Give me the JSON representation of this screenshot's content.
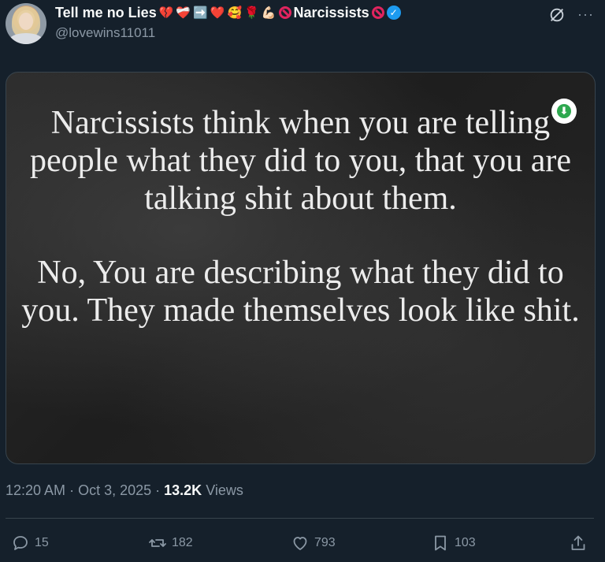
{
  "author": {
    "display_name": "Tell me no Lies",
    "name_suffix": "Narcissists",
    "emojis": [
      "💔",
      "❤️‍🩹",
      "➡️",
      "❤️",
      "🥰",
      "🌹",
      "💪🏻"
    ],
    "handle": "@lovewins11011",
    "verified": true
  },
  "media": {
    "paragraph_1": "Narcissists think when you are telling people what they did to you, that you are talking shit about them.",
    "paragraph_2": "No, You are describing what they did to you. They made themselves look like shit."
  },
  "meta": {
    "time": "12:20 AM",
    "separator": " · ",
    "date": "Oct 3, 2025",
    "views_count": "13.2K",
    "views_label": "Views"
  },
  "actions": {
    "replies": "15",
    "reposts": "182",
    "likes": "793",
    "bookmarks": "103"
  },
  "colors": {
    "background": "#15202b",
    "text": "#f7f9f9",
    "muted": "#8b98a5",
    "verified": "#1d9bf0",
    "no_symbol": "#e0245e"
  }
}
